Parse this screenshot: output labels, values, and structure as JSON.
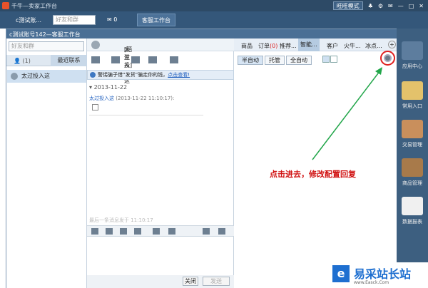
{
  "app": {
    "title": "千牛—卖家工作台",
    "mode_button": "旺旺模式"
  },
  "topbar": {
    "account": "c测试账...",
    "search_placeholder": "好友和群",
    "msg_count": "0",
    "workspace": "客服工作台"
  },
  "window": {
    "title": "c测试账号142—客服工作台",
    "status": "在线"
  },
  "contacts": {
    "search_placeholder": "好友和群",
    "tab_count": "(1)",
    "tab_recent": "最近联系",
    "item": "太过投入这"
  },
  "chat": {
    "user": "太过投入这",
    "tag": "[陌生人]",
    "notice": "警惕骗子借“发货”骗走你的钱，",
    "notice_link": "点击查看!",
    "date": "2013-11-22",
    "sender": "太过投入这",
    "time": "(2013-11-22 11:10:17):",
    "last_msg": "最后一条消息发于 11:10:17",
    "close": "关闭",
    "send": "发送"
  },
  "panel": {
    "tabs": [
      "商品",
      "订单",
      "推荐...",
      "智能...",
      "客户",
      "火牛...",
      "冰点..."
    ],
    "order_badge": "(0)",
    "modes": [
      "半自动",
      "托管",
      "全自动"
    ]
  },
  "annotation": "点击进去，修改配置回复",
  "sidebar": {
    "items": [
      "应用中心",
      "常用入口",
      "交易管理",
      "商品管理",
      "数据报表"
    ]
  },
  "watermark": {
    "logo": "e",
    "name": "易采站长站",
    "site": "www.Easck.Com"
  }
}
